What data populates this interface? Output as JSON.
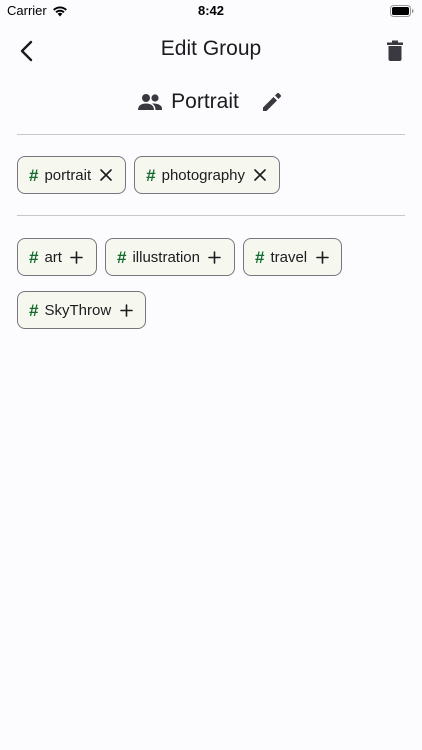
{
  "status_bar": {
    "carrier": "Carrier",
    "time": "8:42"
  },
  "top_bar": {
    "title": "Edit Group",
    "back_icon": "chevron-left-icon",
    "delete_icon": "trash-icon"
  },
  "group": {
    "name": "Portrait",
    "icon": "people-icon",
    "edit_icon": "pencil-icon"
  },
  "selected_tags": [
    {
      "label": "portrait",
      "action": "remove"
    },
    {
      "label": "photography",
      "action": "remove"
    }
  ],
  "suggested_tags": [
    {
      "label": "art",
      "action": "add"
    },
    {
      "label": "illustration",
      "action": "add"
    },
    {
      "label": "travel",
      "action": "add"
    },
    {
      "label": "SkyThrow",
      "action": "add"
    }
  ],
  "colors": {
    "hash": "#146c2e",
    "chip_border": "#79747e",
    "chip_bg": "#f6f8ef",
    "background": "#fcfcff"
  }
}
